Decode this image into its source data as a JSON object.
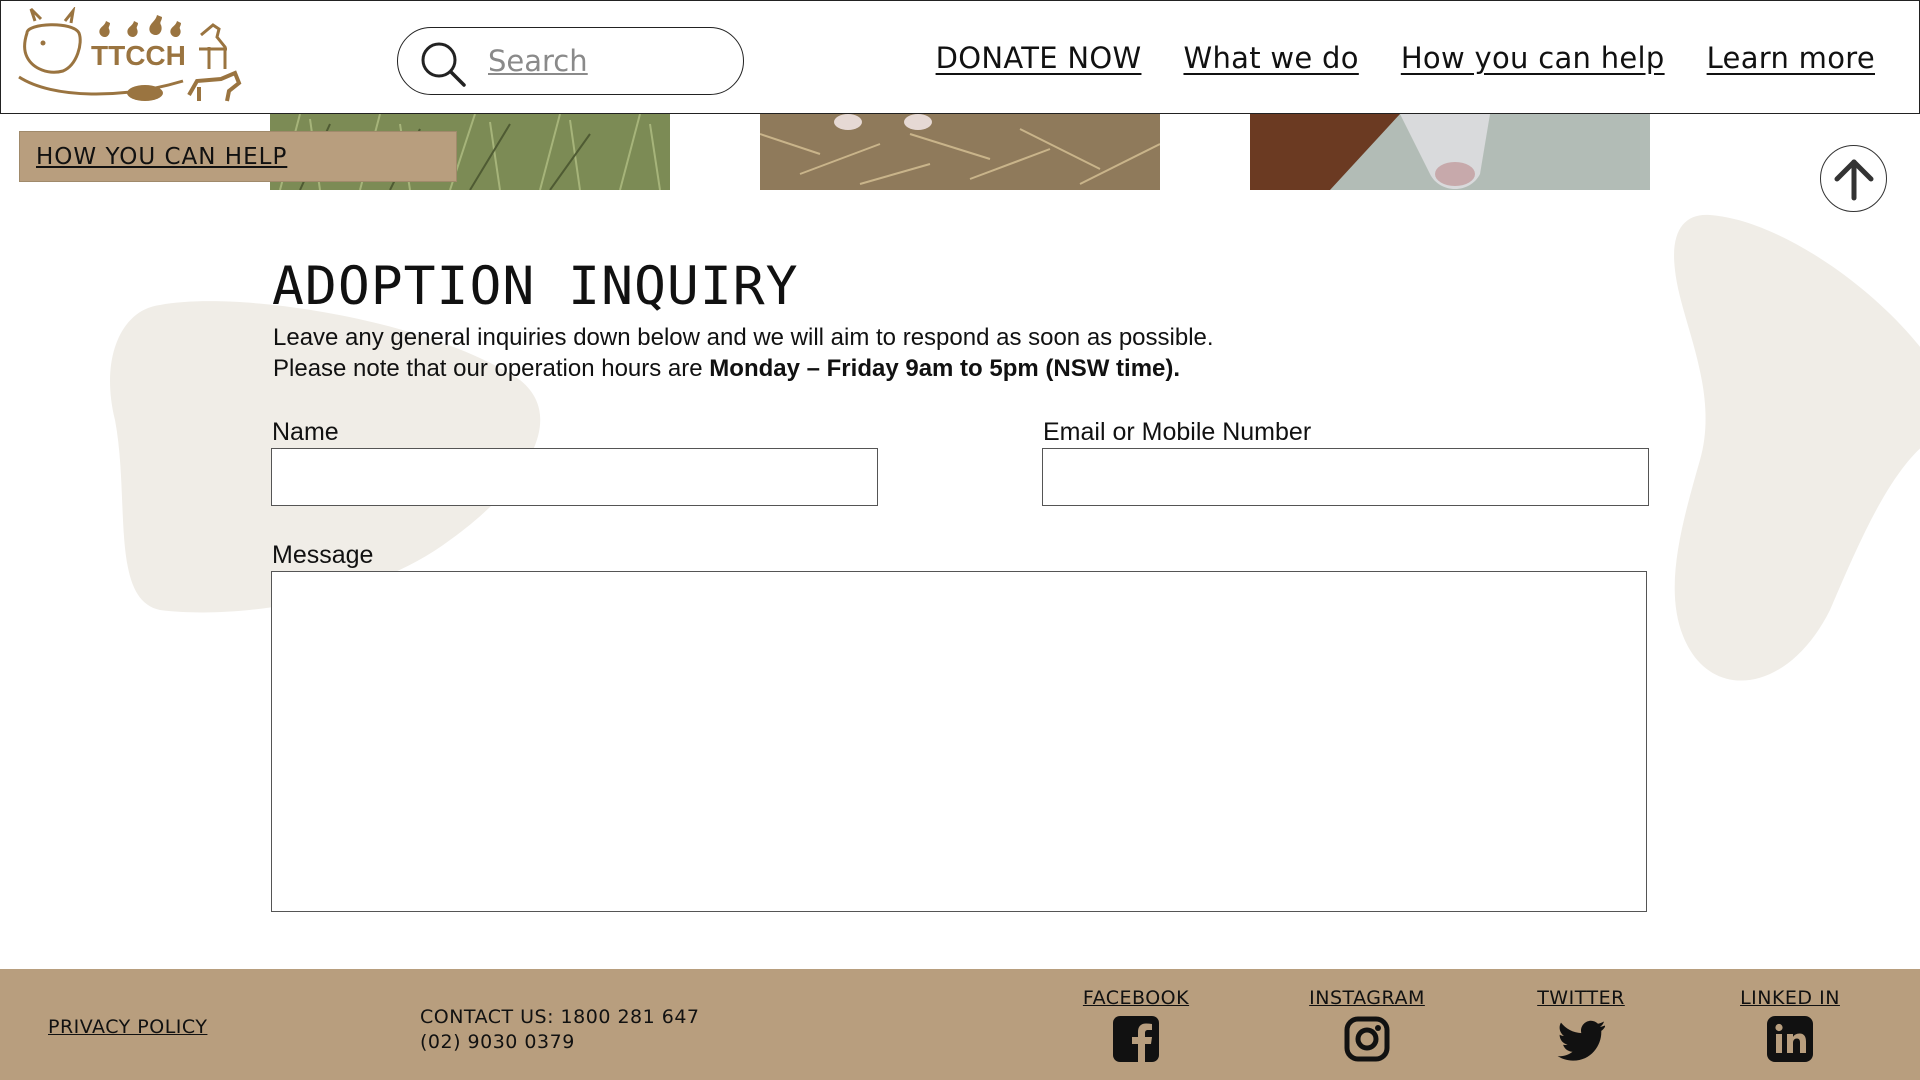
{
  "header": {
    "logo_text": "TTCCH",
    "search": {
      "placeholder": "Search"
    },
    "nav": {
      "donate": "DONATE NOW",
      "what_we_do": "What we do",
      "how_you_can_help": "How you can help",
      "learn_more": "Learn more"
    }
  },
  "section_tag": "HOW YOU CAN HELP",
  "main": {
    "title": "ADOPTION INQUIRY",
    "intro_line1": "Leave any general inquiries down below and we will aim to respond as soon as possible.",
    "intro_line2_prefix": "Please note that our operation hours are ",
    "intro_line2_bold": "Monday – Friday 9am to 5pm (NSW time).",
    "form": {
      "name_label": "Name",
      "name_value": "",
      "contact_label": "Email or Mobile Number",
      "contact_value": "",
      "message_label": "Message",
      "message_value": ""
    }
  },
  "footer": {
    "privacy": "PRIVACY POLICY",
    "contact_line1": "CONTACT US: 1800 281 647",
    "contact_line2": "(02) 9030 0379",
    "social": {
      "facebook": "FACEBOOK",
      "instagram": "INSTAGRAM",
      "twitter": "TWITTER",
      "linkedin": "LINKED IN"
    }
  },
  "colors": {
    "accent": "#b89e7e",
    "logo_brown": "#9a7440",
    "blob": "#f0ede7"
  },
  "icons": [
    "search-icon",
    "arrow-up-icon",
    "facebook-icon",
    "instagram-icon",
    "twitter-icon",
    "linkedin-icon"
  ]
}
